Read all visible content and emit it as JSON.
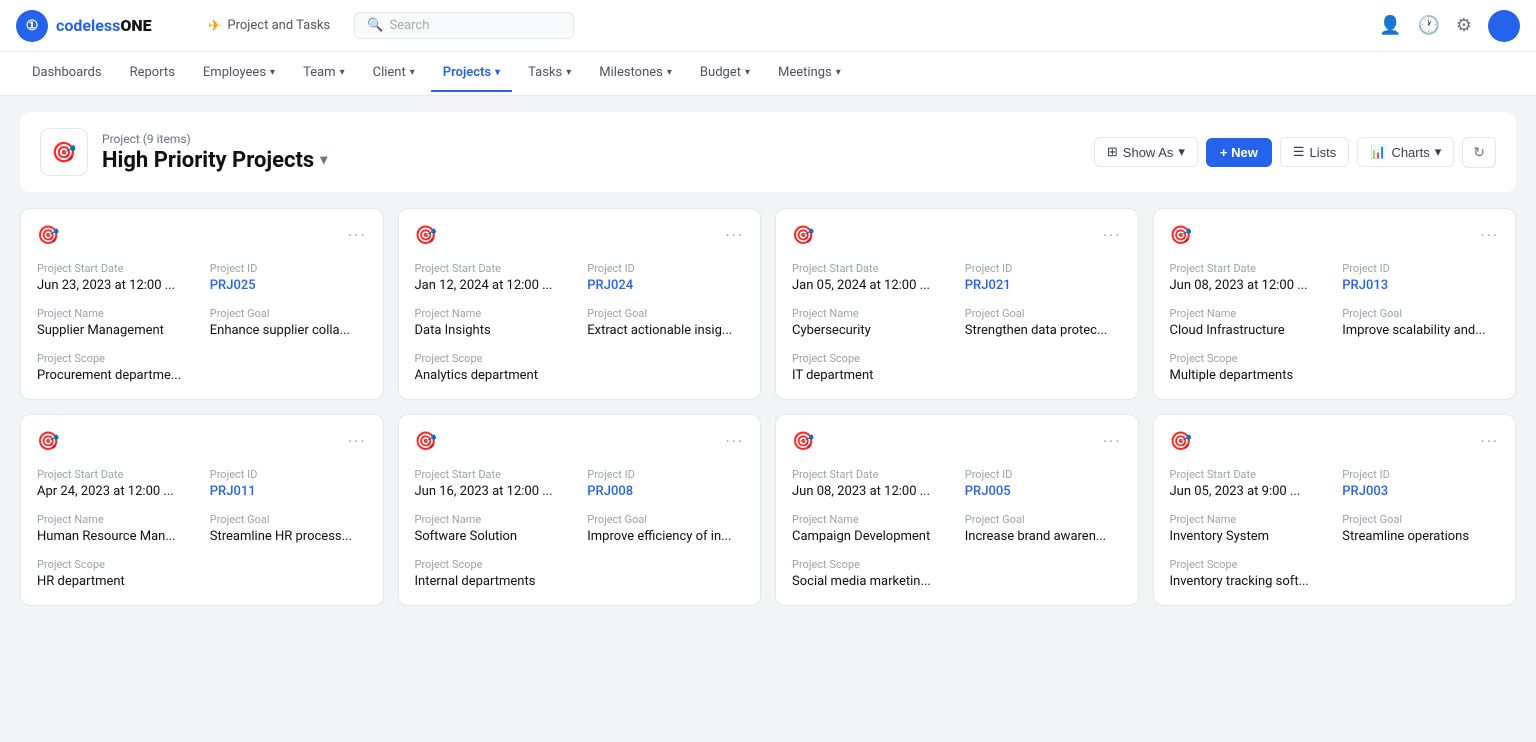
{
  "app": {
    "logo_text_normal": "codeless",
    "logo_text_bold": "ONE",
    "breadcrumb_label": "Project and Tasks",
    "search_placeholder": "Search"
  },
  "top_nav_right": {
    "user_icon": "👤",
    "history_icon": "🕐",
    "settings_icon": "⚙"
  },
  "sec_nav": {
    "items": [
      {
        "label": "Dashboards",
        "has_caret": false,
        "active": false
      },
      {
        "label": "Reports",
        "has_caret": false,
        "active": false
      },
      {
        "label": "Employees",
        "has_caret": true,
        "active": false
      },
      {
        "label": "Team",
        "has_caret": true,
        "active": false
      },
      {
        "label": "Client",
        "has_caret": true,
        "active": false
      },
      {
        "label": "Projects",
        "has_caret": true,
        "active": true
      },
      {
        "label": "Tasks",
        "has_caret": true,
        "active": false
      },
      {
        "label": "Milestones",
        "has_caret": true,
        "active": false
      },
      {
        "label": "Budget",
        "has_caret": true,
        "active": false
      },
      {
        "label": "Meetings",
        "has_caret": true,
        "active": false
      }
    ]
  },
  "page_header": {
    "items_count": "Project (9 items)",
    "title": "High Priority Projects",
    "show_as_label": "Show As",
    "new_label": "+ New",
    "lists_label": "Lists",
    "charts_label": "Charts"
  },
  "projects": [
    {
      "start_date_label": "Project Start Date",
      "start_date": "Jun 23, 2023 at 12:00 ...",
      "id_label": "Project ID",
      "id": "PRJ025",
      "name_label": "Project Name",
      "name": "Supplier Management",
      "goal_label": "Project Goal",
      "goal": "Enhance supplier colla...",
      "scope_label": "Project Scope",
      "scope": "Procurement departme..."
    },
    {
      "start_date_label": "Project Start Date",
      "start_date": "Jan 12, 2024 at 12:00 ...",
      "id_label": "Project ID",
      "id": "PRJ024",
      "name_label": "Project Name",
      "name": "Data Insights",
      "goal_label": "Project Goal",
      "goal": "Extract actionable insig...",
      "scope_label": "Project Scope",
      "scope": "Analytics department"
    },
    {
      "start_date_label": "Project Start Date",
      "start_date": "Jan 05, 2024 at 12:00 ...",
      "id_label": "Project ID",
      "id": "PRJ021",
      "name_label": "Project Name",
      "name": "Cybersecurity",
      "goal_label": "Project Goal",
      "goal": "Strengthen data protec...",
      "scope_label": "Project Scope",
      "scope": "IT department"
    },
    {
      "start_date_label": "Project Start Date",
      "start_date": "Jun 08, 2023 at 12:00 ...",
      "id_label": "Project ID",
      "id": "PRJ013",
      "name_label": "Project Name",
      "name": "Cloud Infrastructure",
      "goal_label": "Project Goal",
      "goal": "Improve scalability and...",
      "scope_label": "Project Scope",
      "scope": "Multiple departments"
    },
    {
      "start_date_label": "Project Start Date",
      "start_date": "Apr 24, 2023 at 12:00 ...",
      "id_label": "Project ID",
      "id": "PRJ011",
      "name_label": "Project Name",
      "name": "Human Resource Man...",
      "goal_label": "Project Goal",
      "goal": "Streamline HR process...",
      "scope_label": "Project Scope",
      "scope": "HR department"
    },
    {
      "start_date_label": "Project Start Date",
      "start_date": "Jun 16, 2023 at 12:00 ...",
      "id_label": "Project ID",
      "id": "PRJ008",
      "name_label": "Project Name",
      "name": "Software Solution",
      "goal_label": "Project Goal",
      "goal": "Improve efficiency of in...",
      "scope_label": "Project Scope",
      "scope": "Internal departments"
    },
    {
      "start_date_label": "Project Start Date",
      "start_date": "Jun 08, 2023 at 12:00 ...",
      "id_label": "Project ID",
      "id": "PRJ005",
      "name_label": "Project Name",
      "name": "Campaign Development",
      "goal_label": "Project Goal",
      "goal": "Increase brand awaren...",
      "scope_label": "Project Scope",
      "scope": "Social media marketin..."
    },
    {
      "start_date_label": "Project Start Date",
      "start_date": "Jun 05, 2023 at 9:00 ...",
      "id_label": "Project ID",
      "id": "PRJ003",
      "name_label": "Project Name",
      "name": "Inventory System",
      "goal_label": "Project Goal",
      "goal": "Streamline operations",
      "scope_label": "Project Scope",
      "scope": "Inventory tracking soft..."
    }
  ]
}
